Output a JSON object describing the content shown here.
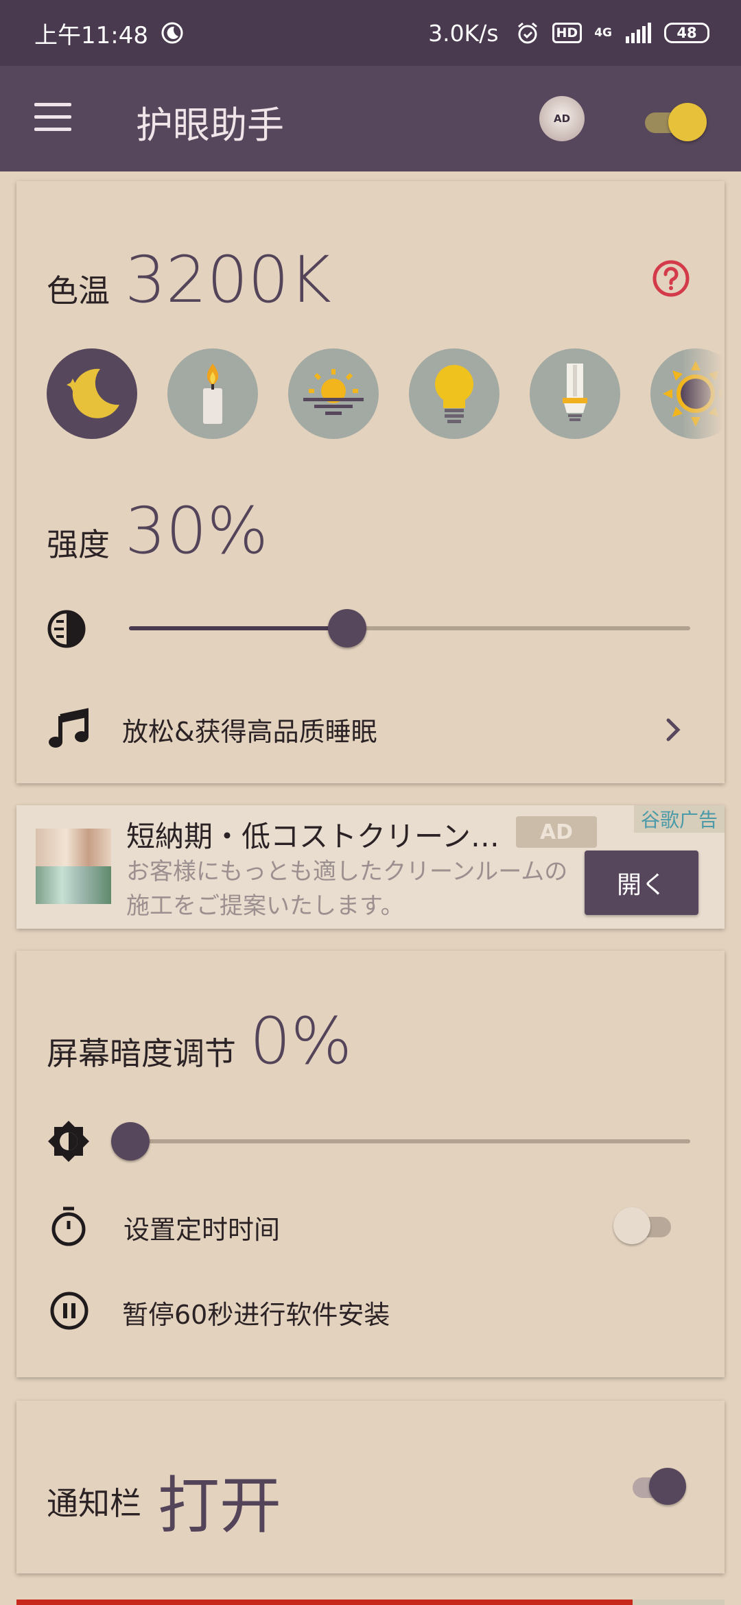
{
  "status_bar": {
    "time": "上午11:48",
    "net_speed": "3.0K/s",
    "hd": "HD",
    "network": "4G",
    "battery": "48"
  },
  "toolbar": {
    "title": "护眼助手",
    "ad_label": "AD",
    "filter_on": true
  },
  "color_temp": {
    "label": "色温",
    "value": "3200K",
    "presets": [
      {
        "name": "moon-icon",
        "active": true
      },
      {
        "name": "candle-icon",
        "active": false
      },
      {
        "name": "sunrise-icon",
        "active": false
      },
      {
        "name": "lightbulb-icon",
        "active": false
      },
      {
        "name": "fluorescent-lamp-icon",
        "active": false
      },
      {
        "name": "sun-icon",
        "active": false
      }
    ]
  },
  "intensity": {
    "label": "强度",
    "value": "30%",
    "level": 0.38
  },
  "sleep": {
    "label": "放松&获得高品质睡眠"
  },
  "ad": {
    "title": "短納期・低コストクリーン…",
    "badge": "AD",
    "corner": "谷歌广告",
    "description": "お客様にもっとも適したクリーンルームの施工をご提案いたします。",
    "button": "開く"
  },
  "dimming": {
    "label": "屏幕暗度调节",
    "value": "0%",
    "level": 0
  },
  "timer": {
    "label": "设置定时时间",
    "on": false
  },
  "pause": {
    "label": "暂停60秒进行软件安装"
  },
  "notification": {
    "label": "通知栏",
    "value": "打开",
    "on": true
  },
  "colors": {
    "accent": "#57475c",
    "background": "#e3d2be",
    "help_red": "#d33a4a",
    "switch_yellow": "#e7c13a"
  }
}
